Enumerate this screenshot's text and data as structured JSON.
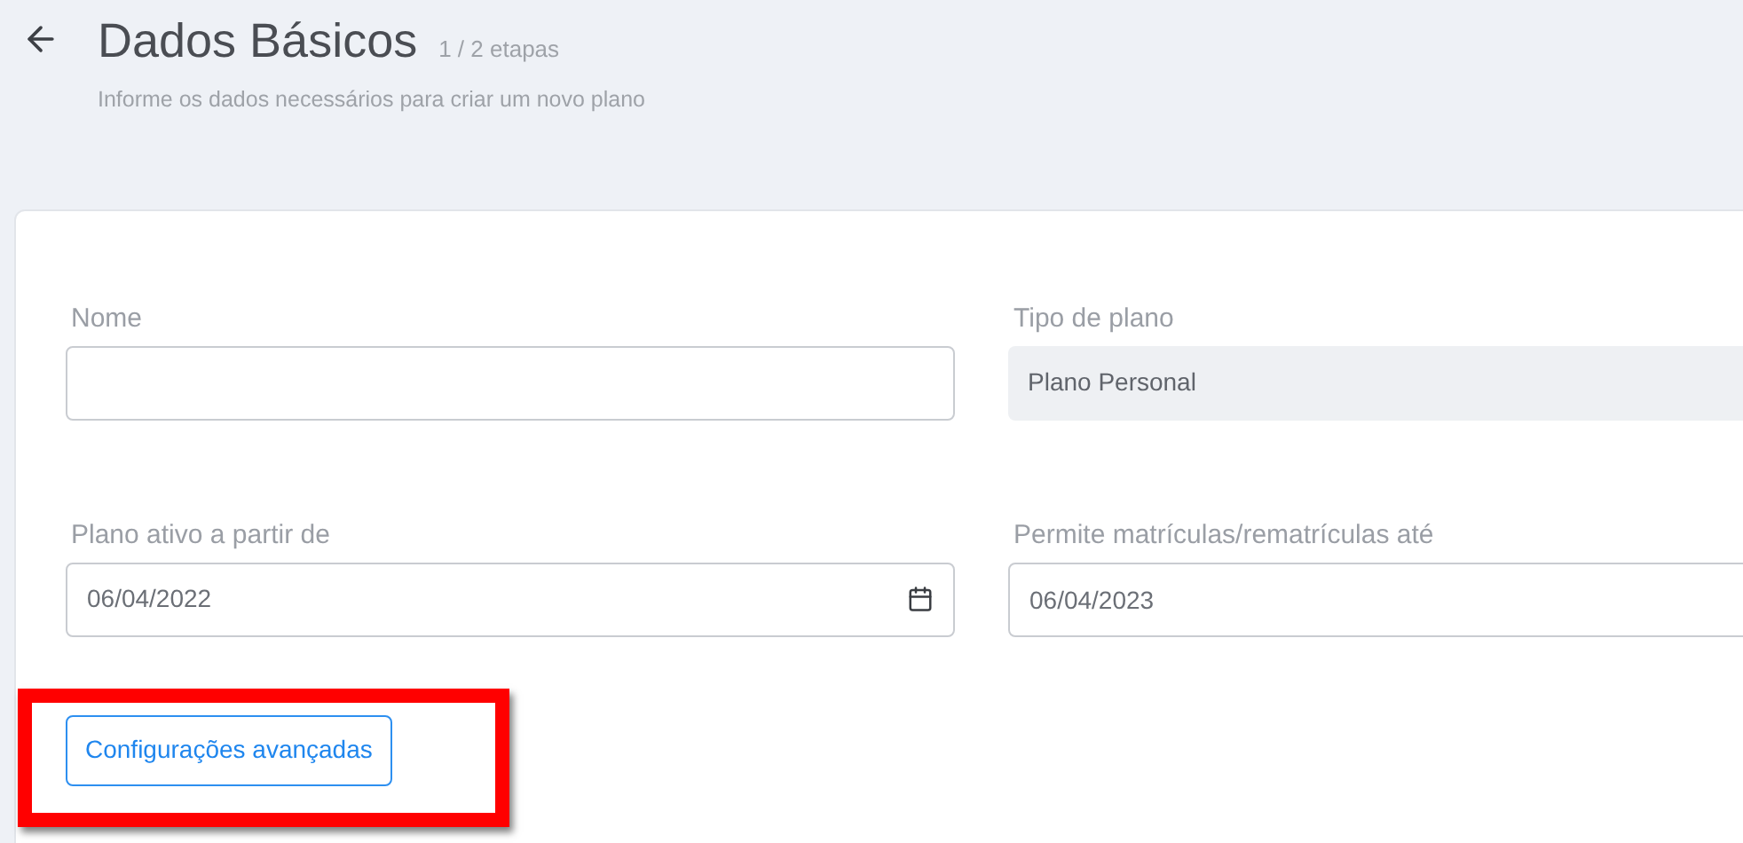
{
  "header": {
    "title": "Dados Básicos",
    "step": "1 / 2 etapas",
    "subtitle": "Informe os dados necessários para criar um novo plano"
  },
  "fields": [
    {
      "label": "Nome",
      "kind": "text"
    },
    {
      "label": "Tipo de plano",
      "kind": "readonly",
      "value": "Plano Personal"
    },
    {
      "label": "Plano ativo a partir de",
      "kind": "date",
      "value": "06/04/2022"
    },
    {
      "label": "Permite matrículas/rematrículas até",
      "kind": "text",
      "value": "06/04/2023"
    }
  ],
  "advanced_button": {
    "label": "Configurações avançadas"
  },
  "annotation": {
    "kind": "highlight_frame"
  }
}
